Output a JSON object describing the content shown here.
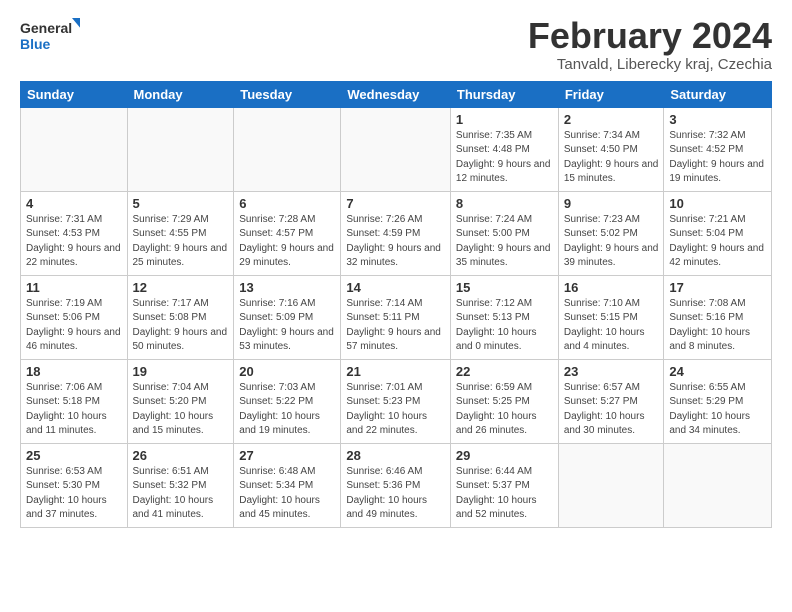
{
  "logo": {
    "line1": "General",
    "line2": "Blue"
  },
  "title": "February 2024",
  "location": "Tanvald, Liberecky kraj, Czechia",
  "days_header": [
    "Sunday",
    "Monday",
    "Tuesday",
    "Wednesday",
    "Thursday",
    "Friday",
    "Saturday"
  ],
  "weeks": [
    [
      {
        "day": "",
        "info": ""
      },
      {
        "day": "",
        "info": ""
      },
      {
        "day": "",
        "info": ""
      },
      {
        "day": "",
        "info": ""
      },
      {
        "day": "1",
        "info": "Sunrise: 7:35 AM\nSunset: 4:48 PM\nDaylight: 9 hours\nand 12 minutes."
      },
      {
        "day": "2",
        "info": "Sunrise: 7:34 AM\nSunset: 4:50 PM\nDaylight: 9 hours\nand 15 minutes."
      },
      {
        "day": "3",
        "info": "Sunrise: 7:32 AM\nSunset: 4:52 PM\nDaylight: 9 hours\nand 19 minutes."
      }
    ],
    [
      {
        "day": "4",
        "info": "Sunrise: 7:31 AM\nSunset: 4:53 PM\nDaylight: 9 hours\nand 22 minutes."
      },
      {
        "day": "5",
        "info": "Sunrise: 7:29 AM\nSunset: 4:55 PM\nDaylight: 9 hours\nand 25 minutes."
      },
      {
        "day": "6",
        "info": "Sunrise: 7:28 AM\nSunset: 4:57 PM\nDaylight: 9 hours\nand 29 minutes."
      },
      {
        "day": "7",
        "info": "Sunrise: 7:26 AM\nSunset: 4:59 PM\nDaylight: 9 hours\nand 32 minutes."
      },
      {
        "day": "8",
        "info": "Sunrise: 7:24 AM\nSunset: 5:00 PM\nDaylight: 9 hours\nand 35 minutes."
      },
      {
        "day": "9",
        "info": "Sunrise: 7:23 AM\nSunset: 5:02 PM\nDaylight: 9 hours\nand 39 minutes."
      },
      {
        "day": "10",
        "info": "Sunrise: 7:21 AM\nSunset: 5:04 PM\nDaylight: 9 hours\nand 42 minutes."
      }
    ],
    [
      {
        "day": "11",
        "info": "Sunrise: 7:19 AM\nSunset: 5:06 PM\nDaylight: 9 hours\nand 46 minutes."
      },
      {
        "day": "12",
        "info": "Sunrise: 7:17 AM\nSunset: 5:08 PM\nDaylight: 9 hours\nand 50 minutes."
      },
      {
        "day": "13",
        "info": "Sunrise: 7:16 AM\nSunset: 5:09 PM\nDaylight: 9 hours\nand 53 minutes."
      },
      {
        "day": "14",
        "info": "Sunrise: 7:14 AM\nSunset: 5:11 PM\nDaylight: 9 hours\nand 57 minutes."
      },
      {
        "day": "15",
        "info": "Sunrise: 7:12 AM\nSunset: 5:13 PM\nDaylight: 10 hours\nand 0 minutes."
      },
      {
        "day": "16",
        "info": "Sunrise: 7:10 AM\nSunset: 5:15 PM\nDaylight: 10 hours\nand 4 minutes."
      },
      {
        "day": "17",
        "info": "Sunrise: 7:08 AM\nSunset: 5:16 PM\nDaylight: 10 hours\nand 8 minutes."
      }
    ],
    [
      {
        "day": "18",
        "info": "Sunrise: 7:06 AM\nSunset: 5:18 PM\nDaylight: 10 hours\nand 11 minutes."
      },
      {
        "day": "19",
        "info": "Sunrise: 7:04 AM\nSunset: 5:20 PM\nDaylight: 10 hours\nand 15 minutes."
      },
      {
        "day": "20",
        "info": "Sunrise: 7:03 AM\nSunset: 5:22 PM\nDaylight: 10 hours\nand 19 minutes."
      },
      {
        "day": "21",
        "info": "Sunrise: 7:01 AM\nSunset: 5:23 PM\nDaylight: 10 hours\nand 22 minutes."
      },
      {
        "day": "22",
        "info": "Sunrise: 6:59 AM\nSunset: 5:25 PM\nDaylight: 10 hours\nand 26 minutes."
      },
      {
        "day": "23",
        "info": "Sunrise: 6:57 AM\nSunset: 5:27 PM\nDaylight: 10 hours\nand 30 minutes."
      },
      {
        "day": "24",
        "info": "Sunrise: 6:55 AM\nSunset: 5:29 PM\nDaylight: 10 hours\nand 34 minutes."
      }
    ],
    [
      {
        "day": "25",
        "info": "Sunrise: 6:53 AM\nSunset: 5:30 PM\nDaylight: 10 hours\nand 37 minutes."
      },
      {
        "day": "26",
        "info": "Sunrise: 6:51 AM\nSunset: 5:32 PM\nDaylight: 10 hours\nand 41 minutes."
      },
      {
        "day": "27",
        "info": "Sunrise: 6:48 AM\nSunset: 5:34 PM\nDaylight: 10 hours\nand 45 minutes."
      },
      {
        "day": "28",
        "info": "Sunrise: 6:46 AM\nSunset: 5:36 PM\nDaylight: 10 hours\nand 49 minutes."
      },
      {
        "day": "29",
        "info": "Sunrise: 6:44 AM\nSunset: 5:37 PM\nDaylight: 10 hours\nand 52 minutes."
      },
      {
        "day": "",
        "info": ""
      },
      {
        "day": "",
        "info": ""
      }
    ]
  ]
}
